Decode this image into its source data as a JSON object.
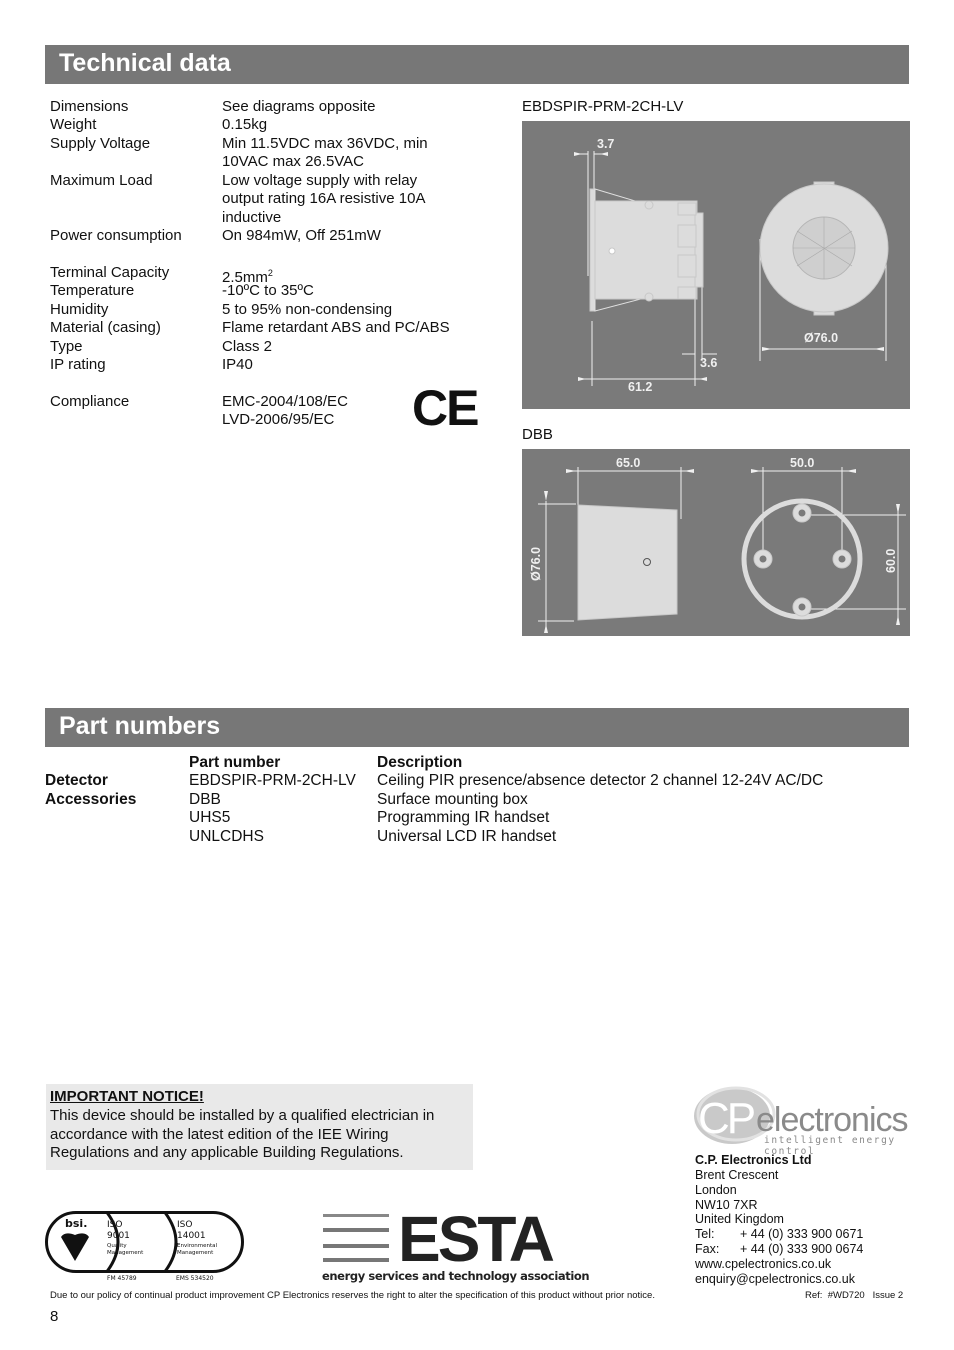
{
  "technical": {
    "heading": "Technical data",
    "specs": [
      {
        "label": "Dimensions",
        "value": "See diagrams opposite"
      },
      {
        "label": "Weight",
        "value": "0.15kg"
      },
      {
        "label": "Supply Voltage",
        "value": "Min 11.5VDC max 36VDC, min 10VAC max 26.5VAC"
      },
      {
        "label": "Maximum Load",
        "value": "Low voltage supply with relay output rating 16A resistive 10A inductive"
      },
      {
        "label": "Power consumption",
        "value": "On 984mW, Off 251mW"
      },
      {
        "label": "Terminal Capacity",
        "value": "2.5mm",
        "superscript": "2"
      },
      {
        "label": "Temperature",
        "value": "-10ºC to 35ºC"
      },
      {
        "label": "Humidity",
        "value": "5 to 95% non-condensing"
      },
      {
        "label": "Material (casing)",
        "value": "Flame retardant ABS and PC/ABS"
      },
      {
        "label": "Type",
        "value": "Class 2"
      },
      {
        "label": "IP rating",
        "value": "IP40"
      },
      {
        "label": "Compliance",
        "value": "EMC-2004/108/EC",
        "value2": "LVD-2006/95/EC"
      }
    ],
    "ce_mark": "CE"
  },
  "diagrams": {
    "detector": {
      "title": "EBDSPIR-PRM-2CH-LV",
      "dims": {
        "flange": "3.7",
        "rear": "3.6",
        "depth": "61.2",
        "diameter": "Ø76.0"
      }
    },
    "box": {
      "title": "DBB",
      "dims": {
        "depth": "65.0",
        "hole_spacing_h": "50.0",
        "hole_spacing_v": "60.0",
        "diameter": "Ø76.0"
      }
    }
  },
  "parts": {
    "heading": "Part numbers",
    "col_part": "Part number",
    "col_desc": "Description",
    "rows": [
      {
        "category": "Detector",
        "part": "EBDSPIR-PRM-2CH-LV",
        "desc": "Ceiling PIR presence/absence detector 2 channel 12-24V AC/DC"
      },
      {
        "category": "Accessories",
        "part": "DBB",
        "desc": "Surface mounting box"
      },
      {
        "category": "",
        "part": "UHS5",
        "desc": "Programming IR handset"
      },
      {
        "category": "",
        "part": "UNLCDHS",
        "desc": "Universal LCD IR handset"
      }
    ]
  },
  "notice": {
    "title": "IMPORTANT NOTICE!",
    "body": "This device should be installed by a qualified electrician in accordance with the latest edition of the IEE Wiring Regulations and any applicable Building Regulations."
  },
  "certs": {
    "bsi": "bsi.",
    "iso1": {
      "std": "ISO",
      "num": "9001",
      "l1": "Quality",
      "l2": "Management",
      "code": "FM 45789"
    },
    "iso2": {
      "std": "ISO",
      "num": "14001",
      "l1": "Environmental",
      "l2": "Management",
      "code": "EMS 534520"
    },
    "esta": "ESTA",
    "esta_sub": "energy services and technology association"
  },
  "company": {
    "logo_cp": "CP",
    "logo_word": "electronics",
    "tagline": "intelligent energy control",
    "name": "C.P. Electronics Ltd",
    "address": [
      "Brent Crescent",
      "London",
      "NW10 7XR",
      "United Kingdom"
    ],
    "tel_label": "Tel:",
    "tel": "+ 44 (0) 333 900 0671",
    "fax_label": "Fax:",
    "fax": "+ 44 (0) 333 900 0674",
    "web": "www.cpelectronics.co.uk",
    "email": "enquiry@cpelectronics.co.uk"
  },
  "footer": {
    "disclaimer": "Due to our policy of continual product improvement CP Electronics reserves the right to alter the specification of this product without prior notice.",
    "ref": "Ref:  #WD720   Issue 2",
    "page": "8"
  }
}
